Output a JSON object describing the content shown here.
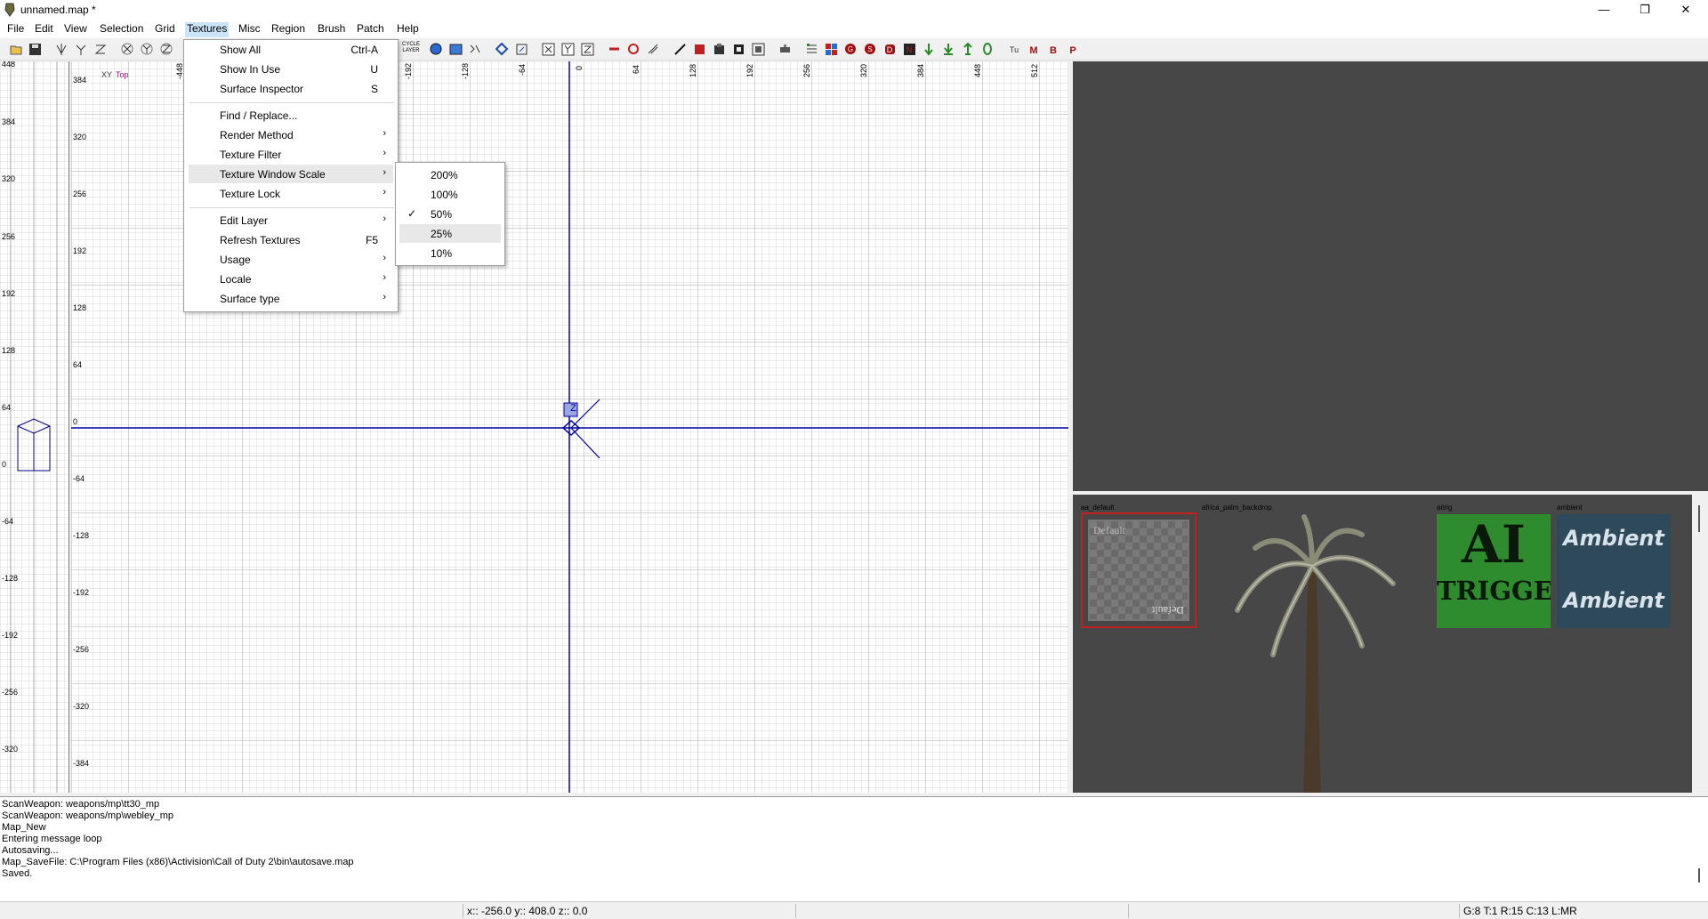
{
  "window": {
    "title": "unnamed.map *",
    "minimize": "—",
    "maximize": "❐",
    "close": "✕"
  },
  "menubar": [
    "File",
    "Edit",
    "View",
    "Selection",
    "Grid",
    "Textures",
    "Misc",
    "Region",
    "Brush",
    "Patch",
    "Help"
  ],
  "textures_menu": {
    "items": [
      {
        "label": "Show All",
        "shortcut": "Ctrl-A"
      },
      {
        "label": "Show In Use",
        "shortcut": "U"
      },
      {
        "label": "Surface Inspector",
        "shortcut": "S"
      },
      {
        "label": "Find / Replace...",
        "shortcut": ""
      },
      {
        "label": "Render Method",
        "submenu": true
      },
      {
        "label": "Texture Filter",
        "submenu": true
      },
      {
        "label": "Texture Window Scale",
        "submenu": true
      },
      {
        "label": "Texture Lock",
        "submenu": true
      },
      {
        "label": "Edit Layer",
        "submenu": true
      },
      {
        "label": "Refresh Textures",
        "shortcut": "F5"
      },
      {
        "label": "Usage",
        "submenu": true
      },
      {
        "label": "Locale",
        "submenu": true
      },
      {
        "label": "Surface type",
        "submenu": true
      }
    ],
    "submenu_arrow": "›"
  },
  "scale_submenu": {
    "items": [
      "200%",
      "100%",
      "50%",
      "25%",
      "10%"
    ],
    "checked": "50%",
    "check_glyph": "✓"
  },
  "toolbar": {
    "cycle_layer": "CYCLE LAYER"
  },
  "xy_view": {
    "label_xy": "XY",
    "label_top": "Top",
    "top_ruler": [
      "-448",
      "-192",
      "-128",
      "-64",
      "0",
      "64",
      "128",
      "192",
      "256",
      "320",
      "384",
      "448",
      "512"
    ],
    "left_ruler": [
      "384",
      "320",
      "256",
      "192",
      "128",
      "64",
      "0",
      "-64",
      "-128",
      "-192",
      "-256",
      "-320",
      "-384"
    ],
    "z_label": "Z"
  },
  "z_view": {
    "ruler": [
      "448",
      "384",
      "320",
      "256",
      "192",
      "128",
      "64",
      "0",
      "-64",
      "-128",
      "-192",
      "-256",
      "-320"
    ]
  },
  "texture_browser": {
    "textures": [
      {
        "name": "aa_default",
        "caption": "Default",
        "caption_flipped": "Default"
      },
      {
        "name": "africa_palm_backdrop"
      },
      {
        "name": "aitrig",
        "line1": "AI",
        "line2": "TRIGGER"
      },
      {
        "name": "ambient",
        "line1": "Ambient",
        "line2": "Ambient"
      }
    ]
  },
  "console": {
    "lines": [
      "ScanWeapon: weapons/mp\\tt30_mp",
      "ScanWeapon: weapons/mp\\webley_mp",
      "Map_New",
      "Entering message loop",
      "Autosaving...",
      "Map_SaveFile: C:\\Program Files (x86)\\Activision\\Call of Duty 2\\bin\\autosave.map",
      "Saved."
    ]
  },
  "status": {
    "coords": "x:: -256.0  y:: 408.0  z:: 0.0",
    "grid_info": "G:8 T:1 R:15 C:13 L:MR"
  },
  "colors": {
    "axis": "#0000a0",
    "view_bg": "#474747",
    "grid_minor": "#d8d8d8",
    "grid_major": "#a8a8a8",
    "selected_texture_border": "#c02020",
    "aitrig_bg": "#2e8b2e",
    "ambient_bg": "#2e4a5a"
  }
}
